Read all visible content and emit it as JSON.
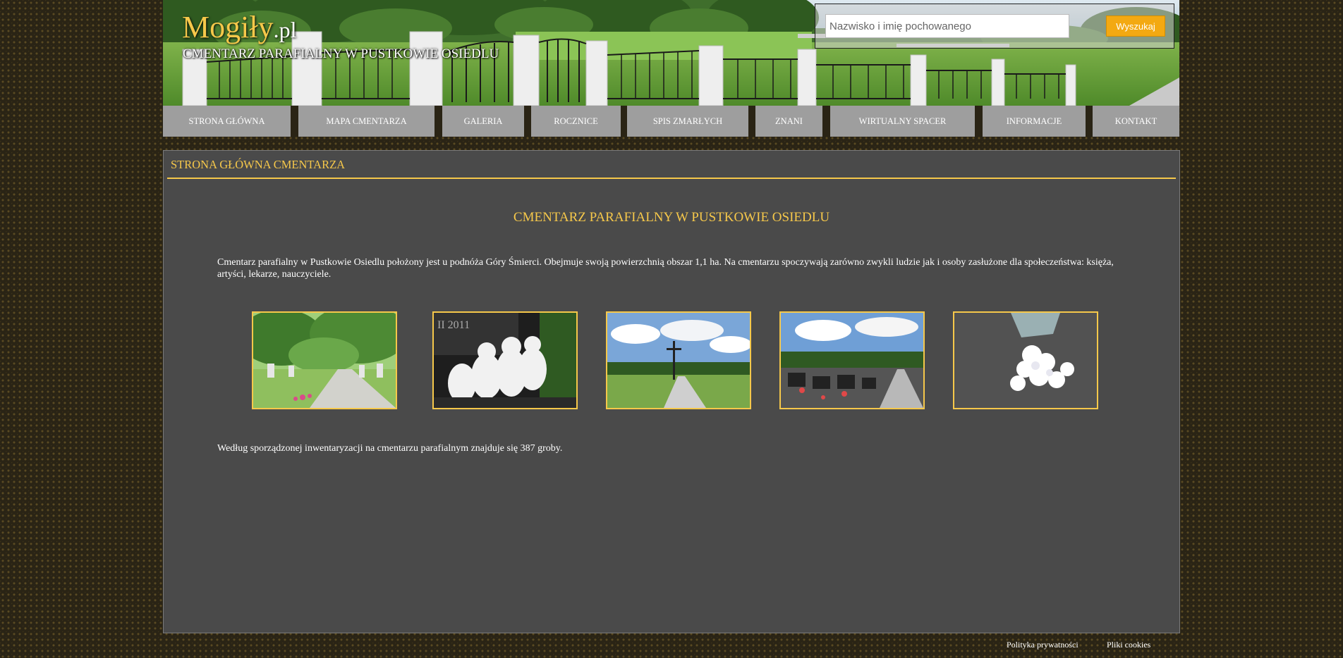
{
  "header": {
    "logo_main": "Mogiły",
    "logo_tld": ".pl",
    "subtitle": "CMENTARZ PARAFIALNY W PUSTKOWIE OSIEDLU"
  },
  "search": {
    "placeholder": "Nazwisko i imię pochowanego",
    "button_label": "Wyszukaj"
  },
  "nav": {
    "items": [
      {
        "label": "STRONA GŁÓWNA"
      },
      {
        "label": "MAPA CMENTARZA"
      },
      {
        "label": "GALERIA"
      },
      {
        "label": "ROCZNICE"
      },
      {
        "label": "SPIS ZMARŁYCH"
      },
      {
        "label": "ZNANI"
      },
      {
        "label": "WIRTUALNY SPACER"
      },
      {
        "label": "INFORMACJE"
      },
      {
        "label": "KONTAKT"
      }
    ]
  },
  "main": {
    "heading": "STRONA GŁÓWNA CMENTARZA",
    "title": "CMENTARZ PARAFIALNY W PUSTKOWIE OSIEDLU",
    "intro": "Cmentarz parafialny w Pustkowie Osiedlu położony jest u podnóża Góry Śmierci. Obejmuje swoją powierzchnią obszar 1,1 ha. Na cmentarzu spoczywają zarówno zwykli ludzie jak i osoby zasłużone dla społeczeństwa: księża, artyści, lekarze, nauczyciele.",
    "summary": "Według sporządzonej inwentaryzacji na cmentarzu parafialnym znajduje się 387 groby."
  },
  "footer": {
    "privacy": "Polityka prywatności",
    "cookies": "Pliki cookies"
  },
  "colors": {
    "accent": "#f6c84a",
    "panel": "#4a4a4a",
    "nav": "#9e9e9e",
    "button": "#f3a912"
  }
}
